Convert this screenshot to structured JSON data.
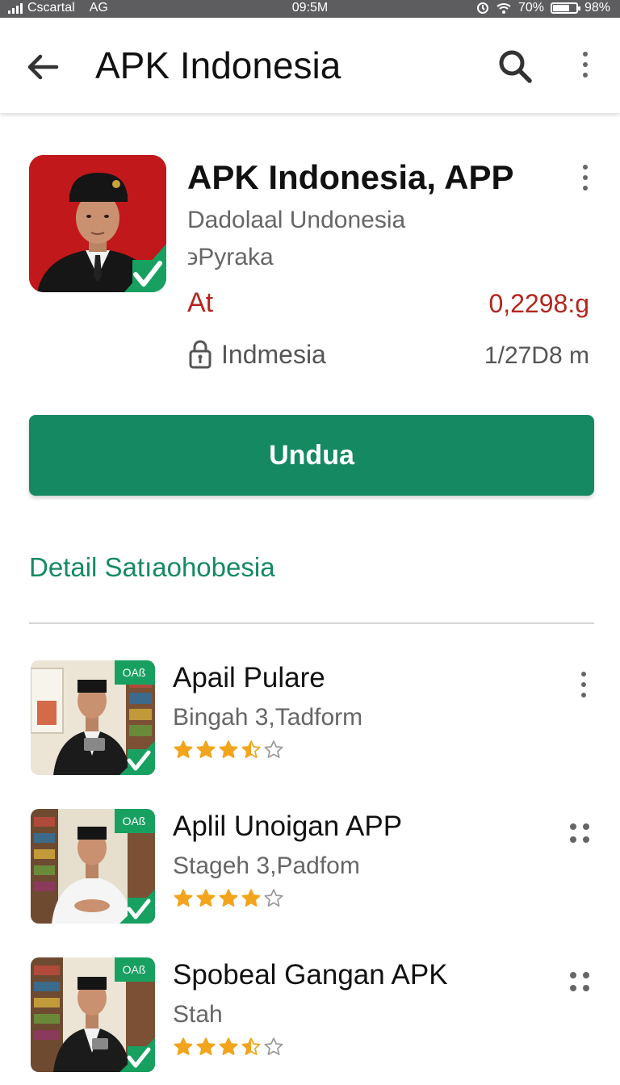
{
  "status_bar": {
    "carrier": "Cscartal",
    "network": "AG",
    "time": "09:5M",
    "wifi_label": "70%",
    "battery_level": 0.7,
    "battery_pct": "98%"
  },
  "appbar": {
    "title": "APK Indonesia",
    "back_icon": "arrow-left-icon",
    "search_icon": "search-icon",
    "menu_icon": "more-vert-icon"
  },
  "app": {
    "name": "APK Indonesia, APP",
    "developer": "Dadolaal Undonesia",
    "subtitle": "϶Pyraka",
    "price_label": "At",
    "price": "0,2298:g",
    "region": "Indmesia",
    "date": "1/27D8 m",
    "install_label": "Undua"
  },
  "section": {
    "title": "Detail Satıaohobesia"
  },
  "list": [
    {
      "title": "Apail Pulare",
      "subtitle": "Bingah 3,Tadform",
      "rating": 3.5,
      "badge": "OAß",
      "menu": "vertical"
    },
    {
      "title": "Aplil Unoigan APP",
      "subtitle": "Stageh 3,Padfom",
      "rating": 4,
      "badge": "OAß",
      "menu": "grid"
    },
    {
      "title": "Spobeal Gangan APK",
      "subtitle": "Stah",
      "rating": 3.5,
      "badge": "OAß",
      "menu": "grid"
    }
  ],
  "colors": {
    "accent": "#158a62",
    "price": "#b3261e",
    "star": "#f2a41c",
    "icon_bg": "#c81a1c"
  }
}
